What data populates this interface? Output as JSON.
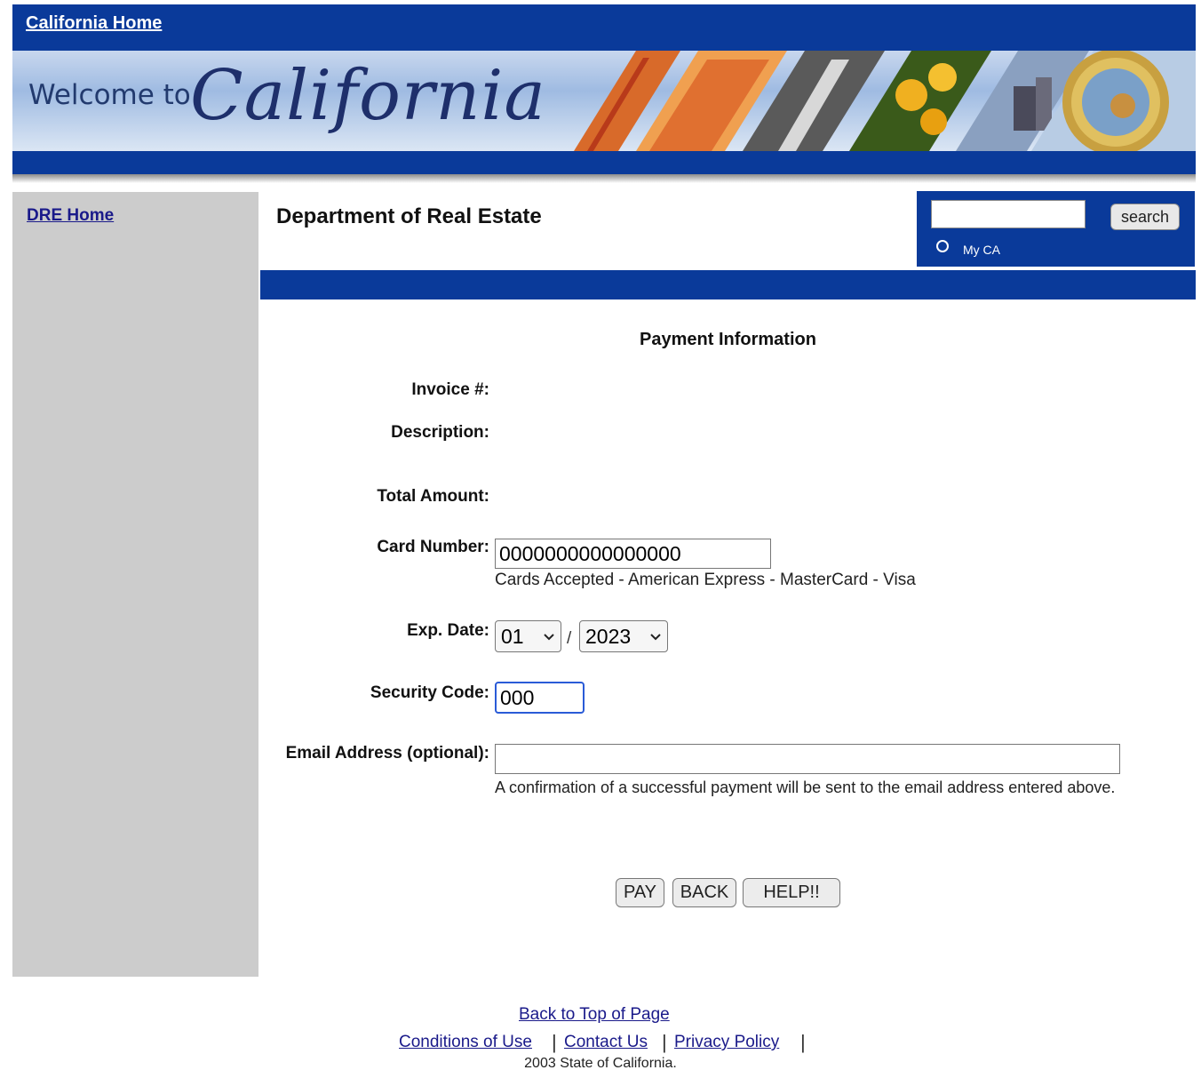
{
  "header": {
    "home_link": "California Home",
    "welcome_text": "Welcome to",
    "state_name": "California"
  },
  "sidebar": {
    "home_link": "DRE Home"
  },
  "page": {
    "department": "Department of Real Estate"
  },
  "search": {
    "value": "",
    "button_label": "search",
    "radio_label": "My CA"
  },
  "form": {
    "title": "Payment Information",
    "invoice_label": "Invoice #:",
    "description_label": "Description:",
    "total_label": "Total Amount:",
    "card_label": "Card Number:",
    "card_value": "0000000000000000",
    "cards_accepted": "Cards Accepted - American Express - MasterCard - Visa",
    "exp_label": "Exp. Date:",
    "exp_month": "01",
    "exp_separator": "/",
    "exp_year": "2023",
    "security_label": "Security Code:",
    "security_value": "000",
    "email_label": "Email Address (optional):",
    "email_value": "",
    "email_note": "A confirmation of a successful payment will be sent to the email address entered above."
  },
  "buttons": {
    "pay": "PAY",
    "back": "BACK",
    "help": "HELP!!"
  },
  "footer": {
    "back_to_top": "Back to Top of Page",
    "conditions": "Conditions of Use",
    "contact": "Contact Us",
    "privacy": "Privacy Policy",
    "separator": "|",
    "copyright": "2003 State of California."
  },
  "colors": {
    "primary_blue": "#0a3a9a",
    "sidebar_gray": "#cccccc",
    "focus_blue": "#2a5bd7"
  }
}
